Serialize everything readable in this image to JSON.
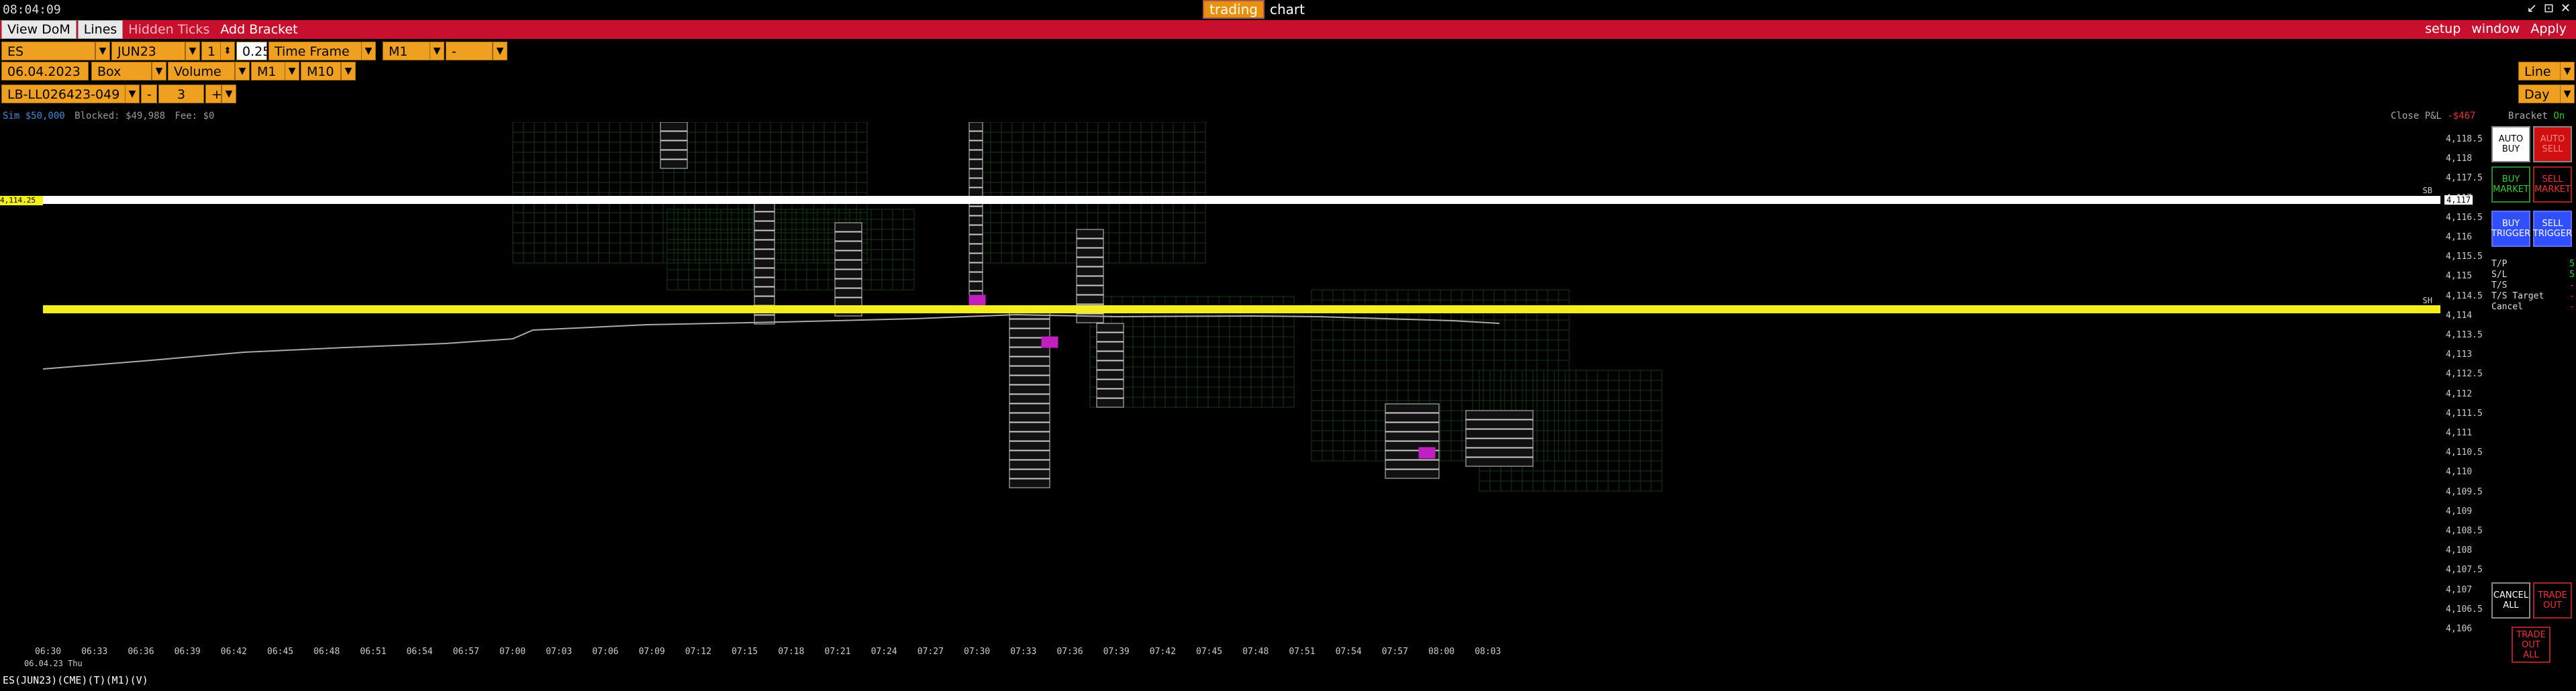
{
  "clock": "08:04:09",
  "app": {
    "title_left": "trading",
    "title_right": "chart"
  },
  "window_controls": [
    "↙",
    "⊡",
    "✕"
  ],
  "toolbar": {
    "left": [
      "View DoM",
      "Lines",
      "Hidden Ticks",
      "Add Bracket"
    ],
    "right": [
      "setup",
      "window",
      "Apply"
    ]
  },
  "controls": {
    "symbol": "ES",
    "contract": "JUN23",
    "qty": "1",
    "tick": "0.25",
    "timeframe_label": "Time Frame",
    "timeframe": "M1",
    "timeframe_extra": "-",
    "date": "06.04.2023",
    "chart_type": "Box",
    "box_mode": "Volume",
    "box_tf1": "M1",
    "box_tf2": "M10",
    "account": "LB-LL026423-049",
    "step_minus": "-",
    "step_value": "3",
    "step_plus": "+",
    "draw_mode": "Line",
    "range": "Day"
  },
  "status": {
    "sim": "Sim $50,000",
    "blocked": "Blocked: $49,988",
    "fee": "Fee: $0",
    "close_pnl": "Close P&L",
    "close_pnl_value": "-$467",
    "bracket": "Bracket",
    "bracket_state": "On"
  },
  "y_ticks": [
    "4,118.5",
    "4,118",
    "4,117.5",
    "4,117",
    "4,116.5",
    "4,116",
    "4,115.5",
    "4,115",
    "4,114.5",
    "4,114",
    "4,113.5",
    "4,113",
    "4,112.5",
    "4,112",
    "4,111.5",
    "4,111",
    "4,110.5",
    "4,110",
    "4,109.5",
    "4,109",
    "4,108.5",
    "4,108",
    "4,107.5",
    "4,107",
    "4,106.5",
    "4,106"
  ],
  "y_markers": {
    "white_line": "4,117",
    "yellow_line": "4,114.25",
    "white_line_tag": "SB",
    "yellow_line_tag": "SH"
  },
  "x_ticks": [
    "06:30",
    "06:33",
    "06:36",
    "06:39",
    "06:42",
    "06:45",
    "06:48",
    "06:51",
    "06:54",
    "06:57",
    "07:00",
    "07:03",
    "07:06",
    "07:09",
    "07:12",
    "07:15",
    "07:18",
    "07:21",
    "07:24",
    "07:27",
    "07:30",
    "07:33",
    "07:36",
    "07:39",
    "07:42",
    "07:45",
    "07:48",
    "07:51",
    "07:54",
    "07:57",
    "08:00",
    "08:03"
  ],
  "x_date": "06.04.23 Thu",
  "trade_buttons": {
    "auto_buy": "AUTO BUY",
    "auto_sell": "AUTO SELL",
    "buy_market": "BUY MARKET",
    "sell_market": "SELL MARKET",
    "buy_trigger": "BUY TRIGGER",
    "sell_trigger": "SELL TRIGGER",
    "cancel_all": "CANCEL ALL",
    "trade_out": "TRADE OUT",
    "trade_out_all": "TRADE OUT ALL"
  },
  "order_info": [
    {
      "label": "T/P",
      "value": "5"
    },
    {
      "label": "S/L",
      "value": "5"
    },
    {
      "label": "T/S",
      "value": "-"
    },
    {
      "label": "T/S Target",
      "value": "-"
    },
    {
      "label": "Cancel",
      "value": "-"
    }
  ],
  "footer": "ES(JUN23)(CME)(T)(M1)(V)",
  "colors": {
    "red": "#c8102e",
    "orange": "#f0a020",
    "yellow": "#f5ee1f",
    "magenta": "#c020c0",
    "green": "#2aa02a",
    "blue": "#3050ff"
  }
}
